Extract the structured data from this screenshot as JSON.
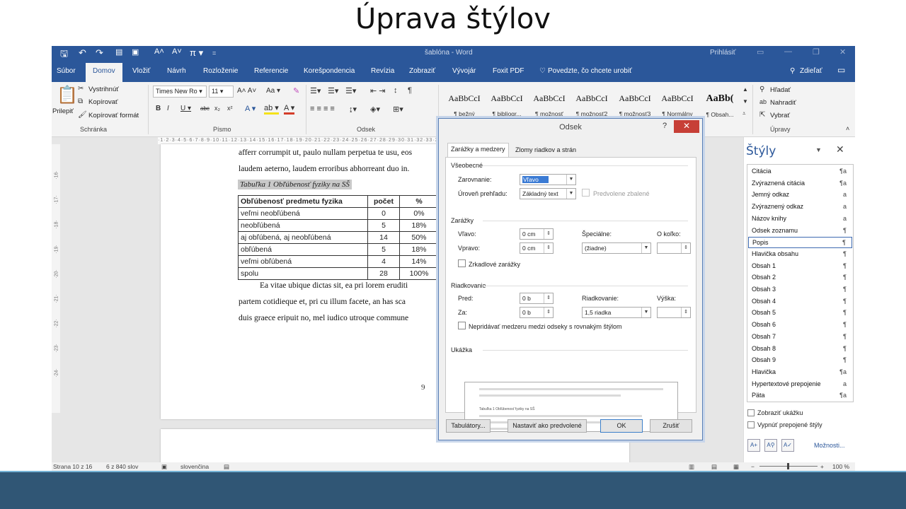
{
  "slide_title": "Úprava štýlov",
  "titlebar": {
    "window_title": "šablóna - Word",
    "signin": "Prihlásiť"
  },
  "tabs": [
    "Súbor",
    "Domov",
    "Vložiť",
    "Návrh",
    "Rozloženie",
    "Referencie",
    "Korešpondencia",
    "Revízia",
    "Zobraziť",
    "Vývojár",
    "Foxit PDF",
    "Povedzte, čo chcete urobiť",
    "Zdieľať"
  ],
  "ribbon": {
    "clipboard": {
      "paste": "Prilepiť",
      "cut": "Vystrihnúť",
      "copy": "Kopírovať",
      "format_painter": "Kopírovať formát",
      "label": "Schránka"
    },
    "font": {
      "name": "Times New Ro",
      "size": "11",
      "label": "Písmo"
    },
    "paragraph": {
      "label": "Odsek"
    },
    "styles": [
      {
        "sample": "AaBbCcI",
        "name": "¶ bežný"
      },
      {
        "sample": "AaBbCcI",
        "name": "¶ bibliogr..."
      },
      {
        "sample": "AaBbCcI",
        "name": "¶ možnosť"
      },
      {
        "sample": "AaBbCcI",
        "name": "¶ možnosť2"
      },
      {
        "sample": "AaBbCcI",
        "name": "¶ možnosť3"
      },
      {
        "sample": "AaBbCcI",
        "name": "¶ Normálny"
      },
      {
        "sample": "AaBb(",
        "name": "¶ Obsah..."
      }
    ],
    "editing": {
      "find": "Hľadať",
      "replace": "Nahradiť",
      "select": "Vybrať",
      "label": "Úpravy"
    }
  },
  "document": {
    "line1": "afferr corrumpit ut, paulo nullam perpetua te usu, eos",
    "line2": "laudem aeterno, laudem erroribus abhorreant duo in.",
    "caption": "Tabuľka 1 Obľúbenosť fyziky na SŠ",
    "table": {
      "headers": [
        "Obľúbenosť predmetu fyzika",
        "počet",
        "%"
      ],
      "rows": [
        [
          "veľmi neobľúbená",
          "0",
          "0%"
        ],
        [
          "neobľúbená",
          "5",
          "18%"
        ],
        [
          "aj obľúbená, aj neobľúbená",
          "14",
          "50%"
        ],
        [
          "obľúbená",
          "5",
          "18%"
        ],
        [
          "veľmi obľúbená",
          "4",
          "14%"
        ],
        [
          "spolu",
          "28",
          "100%"
        ]
      ]
    },
    "para1": "Ea vitae ubique dictas sit, ea pri lorem eruditi",
    "para2": "partem cotidieque et, pri cu illum facete, an has sca",
    "para3": "duis graece eripuit no, mel iudico utroque commune",
    "page_number": "9"
  },
  "dialog": {
    "title": "Odsek",
    "help": "?",
    "close": "✕",
    "tab1": "Zarážky a medzery",
    "tab2": "Zlomy riadkov a strán",
    "general": "Všeobecné",
    "alignment_label": "Zarovnanie:",
    "alignment_value": "Vľavo",
    "outline_label": "Úroveň prehľadu:",
    "outline_value": "Základný text",
    "collapsed": "Predvolene zbalené",
    "indent": "Zarážky",
    "left_label": "Vľavo:",
    "left_value": "0 cm",
    "right_label": "Vpravo:",
    "right_value": "0 cm",
    "special_label": "Špeciálne:",
    "special_value": "(žiadne)",
    "by_label": "O koľko:",
    "mirror": "Zrkadlové zarážky",
    "spacing": "Riadkovanie",
    "before_label": "Pred:",
    "before_value": "0 b",
    "after_label": "Za:",
    "after_value": "0 b",
    "line_label": "Riadkovanie:",
    "line_value": "1,5 riadka",
    "at_label": "Výška:",
    "dont_add": "Nepridávať medzeru medzi odseky s rovnakým štýlom",
    "preview": "Ukážka",
    "preview_caption": "Tabuľka 1 Obľúbenosť fyziky na SŠ",
    "btn_tabs": "Tabulátory...",
    "btn_default": "Nastaviť ako predvolené",
    "btn_ok": "OK",
    "btn_cancel": "Zrušiť"
  },
  "styles_pane": {
    "title": "Štýly",
    "items": [
      {
        "name": "Citácia",
        "glyph": "¶a"
      },
      {
        "name": "Zvýraznená citácia",
        "glyph": "¶a"
      },
      {
        "name": "Jemný odkaz",
        "glyph": "a"
      },
      {
        "name": "Zvýraznený odkaz",
        "glyph": "a"
      },
      {
        "name": "Názov knihy",
        "glyph": "a"
      },
      {
        "name": "Odsek zoznamu",
        "glyph": "¶"
      },
      {
        "name": "Popis",
        "glyph": "¶"
      },
      {
        "name": "Hlavička obsahu",
        "glyph": "¶"
      },
      {
        "name": "Obsah 1",
        "glyph": "¶"
      },
      {
        "name": "Obsah 2",
        "glyph": "¶"
      },
      {
        "name": "Obsah 3",
        "glyph": "¶"
      },
      {
        "name": "Obsah 4",
        "glyph": "¶"
      },
      {
        "name": "Obsah 5",
        "glyph": "¶"
      },
      {
        "name": "Obsah 6",
        "glyph": "¶"
      },
      {
        "name": "Obsah 7",
        "glyph": "¶"
      },
      {
        "name": "Obsah 8",
        "glyph": "¶"
      },
      {
        "name": "Obsah 9",
        "glyph": "¶"
      },
      {
        "name": "Hlavička",
        "glyph": "¶a"
      },
      {
        "name": "Hypertextové prepojenie",
        "glyph": "a"
      },
      {
        "name": "Päta",
        "glyph": "¶a"
      }
    ],
    "selected": "Popis",
    "show_preview": "Zobraziť ukážku",
    "disable_linked": "Vypnúť prepojené štýly",
    "options": "Možnosti..."
  },
  "statusbar": {
    "page": "Strana 10 z 16",
    "words": "6 z 840 slov",
    "language": "slovenčina",
    "zoom": "100 %"
  },
  "colors": {
    "word_blue": "#2b579a",
    "footer_bar": "#305675",
    "close_red": "#c73f37"
  }
}
